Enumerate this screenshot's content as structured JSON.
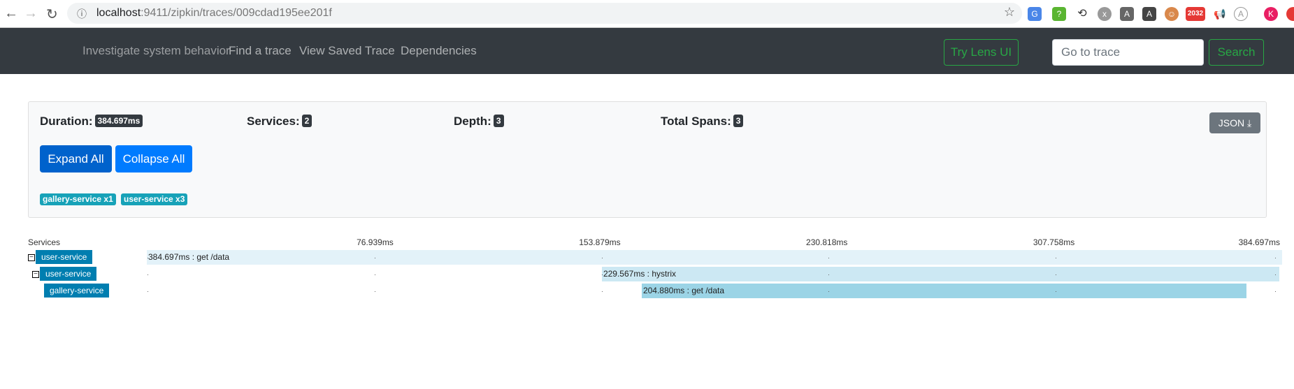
{
  "browser": {
    "url_host": "localhost",
    "url_rest": ":9411/zipkin/traces/009cdad195ee201f",
    "ext_badge": "2032",
    "profile": "K"
  },
  "navbar": {
    "tagline": "Investigate system behavior",
    "links": [
      "Find a trace",
      "View Saved Trace",
      "Dependencies"
    ],
    "lens_button": "Try Lens UI",
    "goto_placeholder": "Go to trace",
    "search_button": "Search"
  },
  "summary": {
    "duration_label": "Duration:",
    "duration": "384.697ms",
    "services_label": "Services:",
    "services": "2",
    "depth_label": "Depth:",
    "depth": "3",
    "spans_label": "Total Spans:",
    "spans": "3",
    "json_button": "JSON",
    "expand_all": "Expand All",
    "collapse_all": "Collapse All",
    "service_badges": [
      "gallery-service x1",
      "user-service x3"
    ]
  },
  "timeline": {
    "header": "Services",
    "total_ms": 384.697,
    "ticks": [
      "76.939ms",
      "153.879ms",
      "230.818ms",
      "307.758ms",
      "384.697ms"
    ],
    "spans": [
      {
        "service": "user-service",
        "label": "384.697ms : get /data",
        "start_ms": 0,
        "duration_ms": 384.697,
        "depth": 0,
        "toggle": "−",
        "color": "#e3f2f9"
      },
      {
        "service": "user-service",
        "label": "229.567ms : hystrix",
        "start_ms": 154.2,
        "duration_ms": 229.567,
        "depth": 1,
        "toggle": "−",
        "color": "#cce8f3"
      },
      {
        "service": "gallery-service",
        "label": "204.880ms : get /data",
        "start_ms": 167.7,
        "duration_ms": 204.88,
        "depth": 2,
        "toggle": "",
        "color": "#9bd4e6"
      }
    ]
  }
}
